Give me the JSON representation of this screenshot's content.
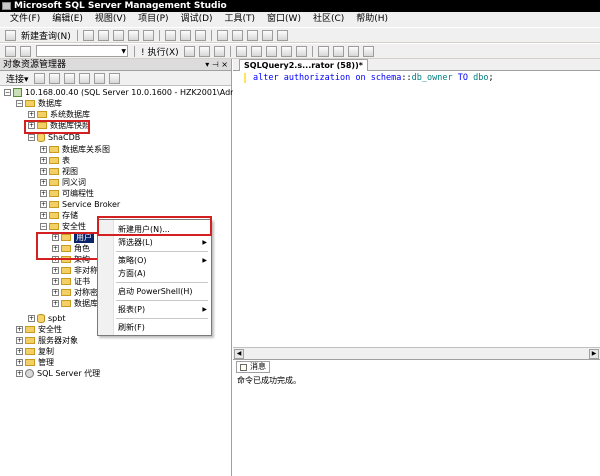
{
  "window": {
    "title": "Microsoft SQL Server Management Studio"
  },
  "menu": [
    "文件(F)",
    "编辑(E)",
    "视图(V)",
    "项目(P)",
    "调试(D)",
    "工具(T)",
    "窗口(W)",
    "社区(C)",
    "帮助(H)"
  ],
  "toolbar": {
    "new_query": "新建查询(N)",
    "execute": "执行(X)"
  },
  "object_explorer": {
    "title": "对象资源管理器",
    "connect": "连接",
    "server_node": "10.168.00.40 (SQL Server 10.0.1600 - HZK2001\\Administ",
    "databases": "数据库",
    "system_databases": "系统数据库",
    "snapshots": "数据库快照",
    "db_shacdb": "ShaCDB",
    "db_items": [
      "数据库关系图",
      "表",
      "视图",
      "同义词",
      "可编程性",
      "Service Broker",
      "存储"
    ],
    "security": "安全性",
    "users": "用户",
    "roles": "角色",
    "architecture": "架构",
    "asym_keys": "非对称",
    "certificates": "证书",
    "sym_keys": "对称密",
    "db_audit": "数据库",
    "db_spbt": "spbt",
    "top_security": "安全性",
    "server_objects": "服务器对象",
    "replication": "复制",
    "management": "管理",
    "agent": "SQL Server 代理"
  },
  "context_menu": {
    "new_user": "新建用户(N)...",
    "filter": "筛选器(L)",
    "policies": "策略(O)",
    "facets": "方面(A)",
    "powershell": "启动 PowerShell(H)",
    "reports": "报表(P)",
    "refresh": "刷新(F)"
  },
  "editor": {
    "tab": "SQLQuery2.s...rator (58))*",
    "code": {
      "kw1": "alter authorization on schema",
      "sep": "::",
      "obj": "db_owner",
      "kw2": "TO",
      "obj2": "dbo",
      "end": ";"
    }
  },
  "results": {
    "tab": "消息",
    "message": "命令已成功完成。"
  }
}
